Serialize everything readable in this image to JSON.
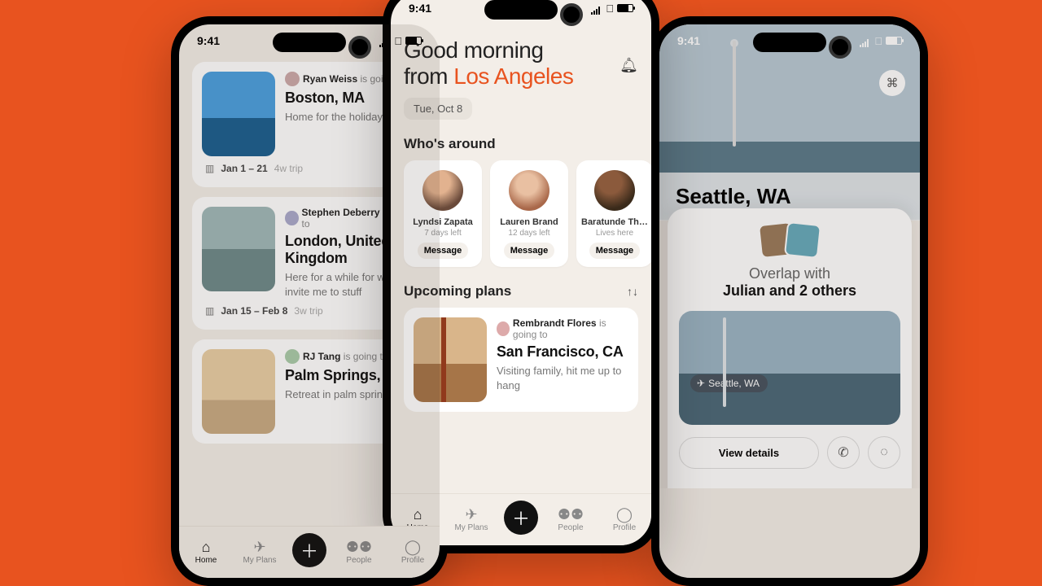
{
  "status": {
    "time": "9:41"
  },
  "tabbar": {
    "home": "Home",
    "myplans": "My Plans",
    "people": "People",
    "profile": "Profile"
  },
  "center": {
    "greeting_line1": "Good morning",
    "greeting_from": "from ",
    "greeting_loc": "Los Angeles",
    "date_pill": "Tue, Oct 8",
    "whos_around": "Who's around",
    "people": [
      {
        "name": "Lyndsi Zapata",
        "sub": "7 days left",
        "action": "Message"
      },
      {
        "name": "Lauren Brand",
        "sub": "12 days left",
        "action": "Message"
      },
      {
        "name": "Baratunde Th…",
        "sub": "Lives here",
        "action": "Message"
      }
    ],
    "upcoming_title": "Upcoming plans",
    "upcoming": {
      "user": "Rembrandt Flores",
      "verb": "is going to",
      "loc": "San Francisco, CA",
      "desc": "Visiting family, hit me up to hang"
    }
  },
  "left": {
    "trips": [
      {
        "user": "Ryan Weiss",
        "verb": "is going to",
        "loc": "Boston, MA",
        "desc": "Home for the holidays",
        "dates": "Jan 1 – 21",
        "len": "4w trip"
      },
      {
        "user": "Stephen Deberry",
        "verb": "is going to",
        "loc": "London, United Kingdom",
        "desc": "Here for a while for work, invite me to stuff",
        "dates": "Jan 15 – Feb 8",
        "len": "3w trip"
      },
      {
        "user": "RJ Tang",
        "verb": "is going to",
        "loc": "Palm Springs, CA",
        "desc": "Retreat in palm springs",
        "dates": "",
        "len": ""
      }
    ]
  },
  "right": {
    "hero_loc": "Seattle, WA",
    "overlap_prefix": "Overlap with",
    "overlap_names": "Julian and 2 others",
    "dest_pill": "Seattle, WA",
    "view_details": "View details"
  }
}
